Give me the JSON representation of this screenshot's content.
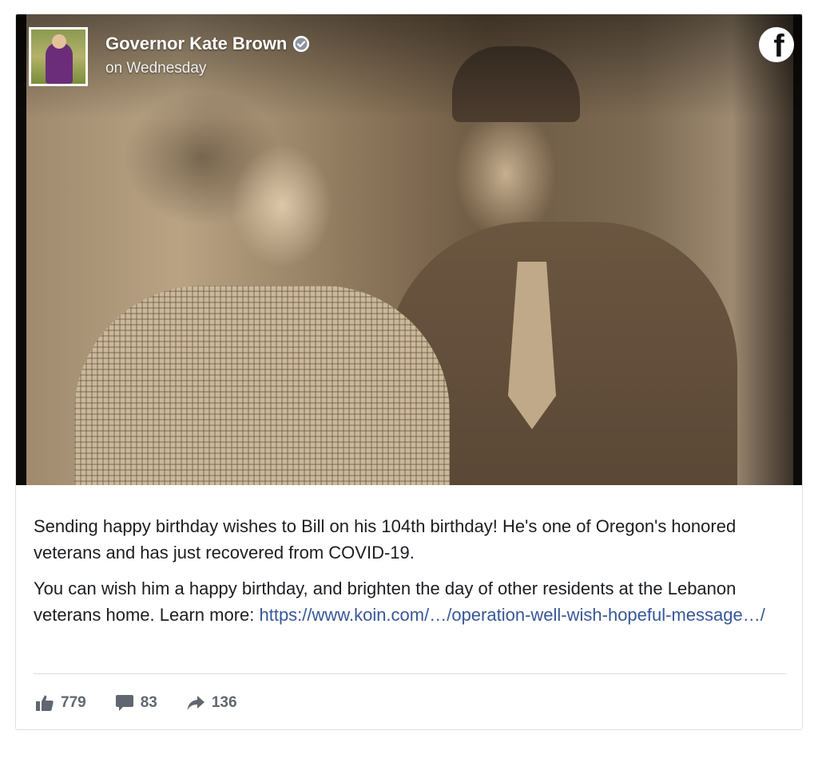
{
  "post": {
    "author": "Governor Kate Brown",
    "timestamp": "on Wednesday",
    "paragraph1": "Sending happy birthday wishes to Bill on his 104th birthday! He's one of Oregon's honored veterans and has just recovered from COVID-19.",
    "paragraph2_text": "You can wish him a happy birthday, and brighten the day of other residents at the Lebanon veterans home. Learn more: ",
    "paragraph2_link": "https://www.koin.com/…/operation-well-wish-hopeful-message…/",
    "icons": {
      "verified": "verified-badge-icon",
      "brand": "facebook-icon",
      "like": "thumbs-up-icon",
      "comment": "comment-icon",
      "share": "share-arrow-icon"
    }
  },
  "stats": {
    "likes": "779",
    "comments": "83",
    "shares": "136"
  },
  "colors": {
    "link": "#385898",
    "text": "#1c1e21",
    "muted": "#606770",
    "border": "#dddfe2"
  }
}
